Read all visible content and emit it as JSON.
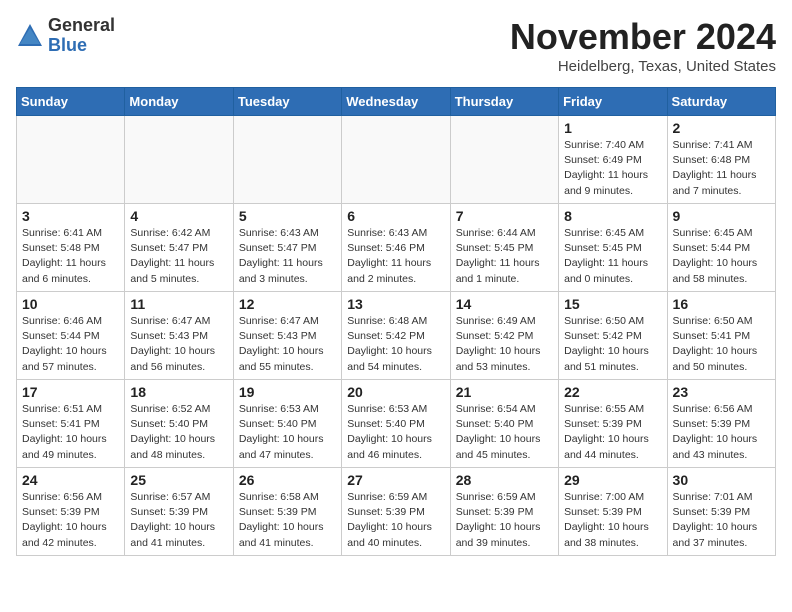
{
  "logo": {
    "general": "General",
    "blue": "Blue"
  },
  "title": "November 2024",
  "subtitle": "Heidelberg, Texas, United States",
  "days_of_week": [
    "Sunday",
    "Monday",
    "Tuesday",
    "Wednesday",
    "Thursday",
    "Friday",
    "Saturday"
  ],
  "weeks": [
    [
      {
        "day": "",
        "info": ""
      },
      {
        "day": "",
        "info": ""
      },
      {
        "day": "",
        "info": ""
      },
      {
        "day": "",
        "info": ""
      },
      {
        "day": "",
        "info": ""
      },
      {
        "day": "1",
        "info": "Sunrise: 7:40 AM\nSunset: 6:49 PM\nDaylight: 11 hours and 9 minutes."
      },
      {
        "day": "2",
        "info": "Sunrise: 7:41 AM\nSunset: 6:48 PM\nDaylight: 11 hours and 7 minutes."
      }
    ],
    [
      {
        "day": "3",
        "info": "Sunrise: 6:41 AM\nSunset: 5:48 PM\nDaylight: 11 hours and 6 minutes."
      },
      {
        "day": "4",
        "info": "Sunrise: 6:42 AM\nSunset: 5:47 PM\nDaylight: 11 hours and 5 minutes."
      },
      {
        "day": "5",
        "info": "Sunrise: 6:43 AM\nSunset: 5:47 PM\nDaylight: 11 hours and 3 minutes."
      },
      {
        "day": "6",
        "info": "Sunrise: 6:43 AM\nSunset: 5:46 PM\nDaylight: 11 hours and 2 minutes."
      },
      {
        "day": "7",
        "info": "Sunrise: 6:44 AM\nSunset: 5:45 PM\nDaylight: 11 hours and 1 minute."
      },
      {
        "day": "8",
        "info": "Sunrise: 6:45 AM\nSunset: 5:45 PM\nDaylight: 11 hours and 0 minutes."
      },
      {
        "day": "9",
        "info": "Sunrise: 6:45 AM\nSunset: 5:44 PM\nDaylight: 10 hours and 58 minutes."
      }
    ],
    [
      {
        "day": "10",
        "info": "Sunrise: 6:46 AM\nSunset: 5:44 PM\nDaylight: 10 hours and 57 minutes."
      },
      {
        "day": "11",
        "info": "Sunrise: 6:47 AM\nSunset: 5:43 PM\nDaylight: 10 hours and 56 minutes."
      },
      {
        "day": "12",
        "info": "Sunrise: 6:47 AM\nSunset: 5:43 PM\nDaylight: 10 hours and 55 minutes."
      },
      {
        "day": "13",
        "info": "Sunrise: 6:48 AM\nSunset: 5:42 PM\nDaylight: 10 hours and 54 minutes."
      },
      {
        "day": "14",
        "info": "Sunrise: 6:49 AM\nSunset: 5:42 PM\nDaylight: 10 hours and 53 minutes."
      },
      {
        "day": "15",
        "info": "Sunrise: 6:50 AM\nSunset: 5:42 PM\nDaylight: 10 hours and 51 minutes."
      },
      {
        "day": "16",
        "info": "Sunrise: 6:50 AM\nSunset: 5:41 PM\nDaylight: 10 hours and 50 minutes."
      }
    ],
    [
      {
        "day": "17",
        "info": "Sunrise: 6:51 AM\nSunset: 5:41 PM\nDaylight: 10 hours and 49 minutes."
      },
      {
        "day": "18",
        "info": "Sunrise: 6:52 AM\nSunset: 5:40 PM\nDaylight: 10 hours and 48 minutes."
      },
      {
        "day": "19",
        "info": "Sunrise: 6:53 AM\nSunset: 5:40 PM\nDaylight: 10 hours and 47 minutes."
      },
      {
        "day": "20",
        "info": "Sunrise: 6:53 AM\nSunset: 5:40 PM\nDaylight: 10 hours and 46 minutes."
      },
      {
        "day": "21",
        "info": "Sunrise: 6:54 AM\nSunset: 5:40 PM\nDaylight: 10 hours and 45 minutes."
      },
      {
        "day": "22",
        "info": "Sunrise: 6:55 AM\nSunset: 5:39 PM\nDaylight: 10 hours and 44 minutes."
      },
      {
        "day": "23",
        "info": "Sunrise: 6:56 AM\nSunset: 5:39 PM\nDaylight: 10 hours and 43 minutes."
      }
    ],
    [
      {
        "day": "24",
        "info": "Sunrise: 6:56 AM\nSunset: 5:39 PM\nDaylight: 10 hours and 42 minutes."
      },
      {
        "day": "25",
        "info": "Sunrise: 6:57 AM\nSunset: 5:39 PM\nDaylight: 10 hours and 41 minutes."
      },
      {
        "day": "26",
        "info": "Sunrise: 6:58 AM\nSunset: 5:39 PM\nDaylight: 10 hours and 41 minutes."
      },
      {
        "day": "27",
        "info": "Sunrise: 6:59 AM\nSunset: 5:39 PM\nDaylight: 10 hours and 40 minutes."
      },
      {
        "day": "28",
        "info": "Sunrise: 6:59 AM\nSunset: 5:39 PM\nDaylight: 10 hours and 39 minutes."
      },
      {
        "day": "29",
        "info": "Sunrise: 7:00 AM\nSunset: 5:39 PM\nDaylight: 10 hours and 38 minutes."
      },
      {
        "day": "30",
        "info": "Sunrise: 7:01 AM\nSunset: 5:39 PM\nDaylight: 10 hours and 37 minutes."
      }
    ]
  ]
}
